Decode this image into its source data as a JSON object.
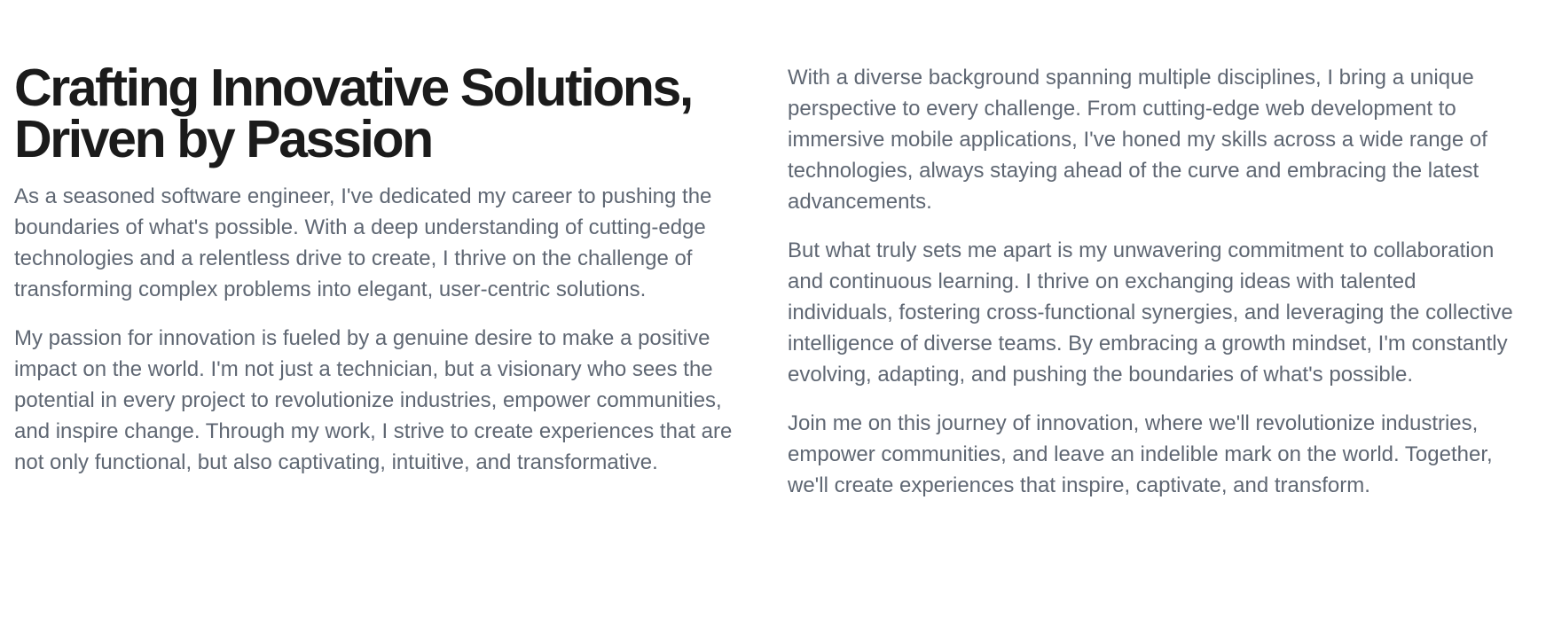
{
  "heading": {
    "line1": "Crafting Innovative Solutions,",
    "line2": "Driven by Passion"
  },
  "left_column": {
    "paragraphs": [
      "As a seasoned software engineer, I've dedicated my career to pushing the boundaries of what's possible. With a deep understanding of cutting-edge technologies and a relentless drive to create, I thrive on the challenge of transforming complex problems into elegant, user-centric solutions.",
      "My passion for innovation is fueled by a genuine desire to make a positive impact on the world. I'm not just a technician, but a visionary who sees the potential in every project to revolutionize industries, empower communities, and inspire change. Through my work, I strive to create experiences that are not only functional, but also captivating, intuitive, and transformative."
    ]
  },
  "right_column": {
    "paragraphs": [
      "With a diverse background spanning multiple disciplines, I bring a unique perspective to every challenge. From cutting-edge web development to immersive mobile applications, I've honed my skills across a wide range of technologies, always staying ahead of the curve and embracing the latest advancements.",
      "But what truly sets me apart is my unwavering commitment to collaboration and continuous learning. I thrive on exchanging ideas with talented individuals, fostering cross-functional synergies, and leveraging the collective intelligence of diverse teams. By embracing a growth mindset, I'm constantly evolving, adapting, and pushing the boundaries of what's possible.",
      "Join me on this journey of innovation, where we'll revolutionize industries, empower communities, and leave an indelible mark on the world. Together, we'll create experiences that inspire, captivate, and transform."
    ]
  },
  "colors": {
    "heading": "#1b1b1b",
    "body_text": "#5f6773",
    "background": "#ffffff"
  }
}
